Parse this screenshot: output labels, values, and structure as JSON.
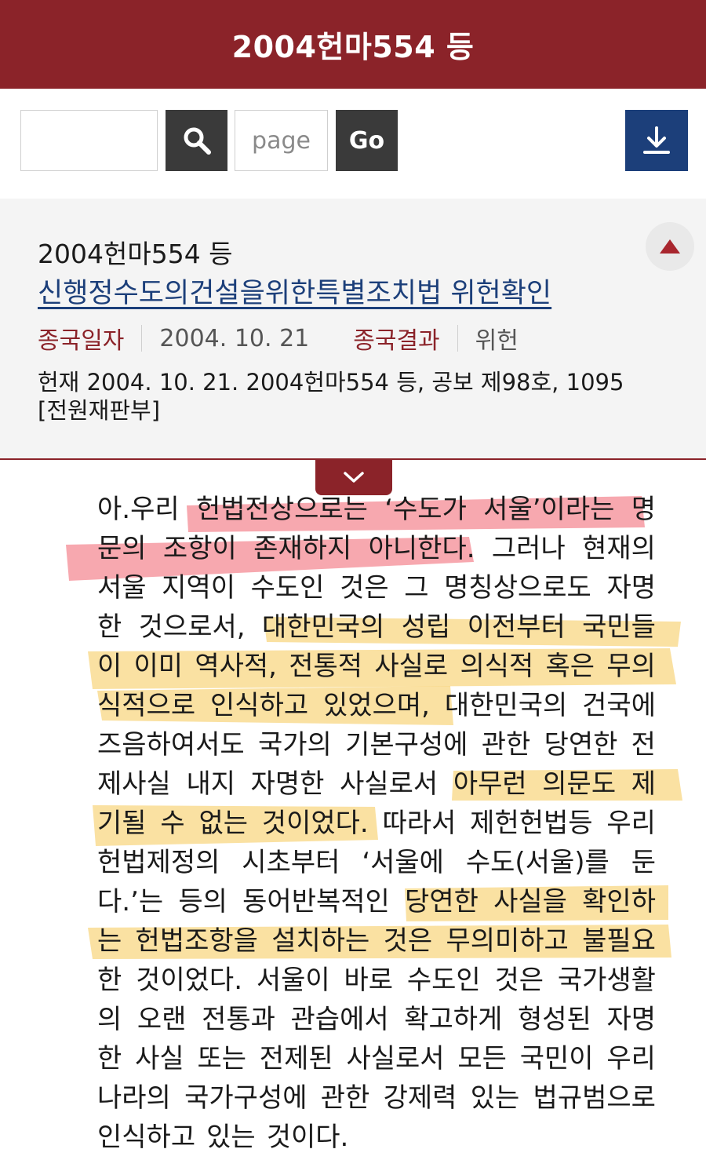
{
  "header": {
    "title": "2004헌마554 등"
  },
  "toolbar": {
    "search_value": "",
    "page_placeholder": "page",
    "go_label": "Go",
    "icons": {
      "search": "search-icon",
      "download": "download-icon"
    }
  },
  "case": {
    "number": "2004헌마554 등",
    "title": "신행정수도의건설을위한특별조치법 위헌확인",
    "closing_date_label": "종국일자",
    "closing_date": "2004. 10. 21",
    "result_label": "종국결과",
    "result": "위헌",
    "citation_line1": "헌재 2004. 10. 21. 2004헌마554 등, 공보 제98호, 1095",
    "citation_line2": "[전원재판부]"
  },
  "colors": {
    "brand": "#8b2329",
    "download": "#1c3f7a",
    "highlight_red": "#f0606e",
    "highlight_yellow": "#f6c445"
  },
  "document": {
    "lines": [
      "아.우리 헌법전상으로는 ‘수도가 서울’이라는 명",
      "문의 조항이 존재하지 아니한다. 그러나 현재의",
      "서울 지역이 수도인 것은 그 명칭상으로도 자명",
      "한 것으로서, 대한민국의 성립 이전부터 국민들",
      "이 이미 역사적, 전통적 사실로 의식적 혹은 무의",
      "식적으로 인식하고 있었으며, 대한민국의 건국에",
      "즈음하여서도 국가의 기본구성에 관한 당연한 전",
      "제사실 내지 자명한 사실로서 아무런 의문도 제",
      "기될 수 없는 것이었다. 따라서 제헌헌법등 우리",
      "헌법제정의 시초부터 ‘서울에 수도(서울)를 둔",
      "다.’는 등의 동어반복적인 당연한 사실을 확인하",
      "는 헌법조항을 설치하는 것은 무의미하고 불필요",
      "한 것이었다. 서울이 바로 수도인 것은 국가생활",
      "의 오랜 전통과 관습에서 확고하게 형성된 자명",
      "한 사실 또는 전제된 사실로서 모든 국민이 우리",
      "나라의 국가구성에 관한 강제력 있는 법규범으로",
      "인식하고 있는 것이다."
    ]
  }
}
